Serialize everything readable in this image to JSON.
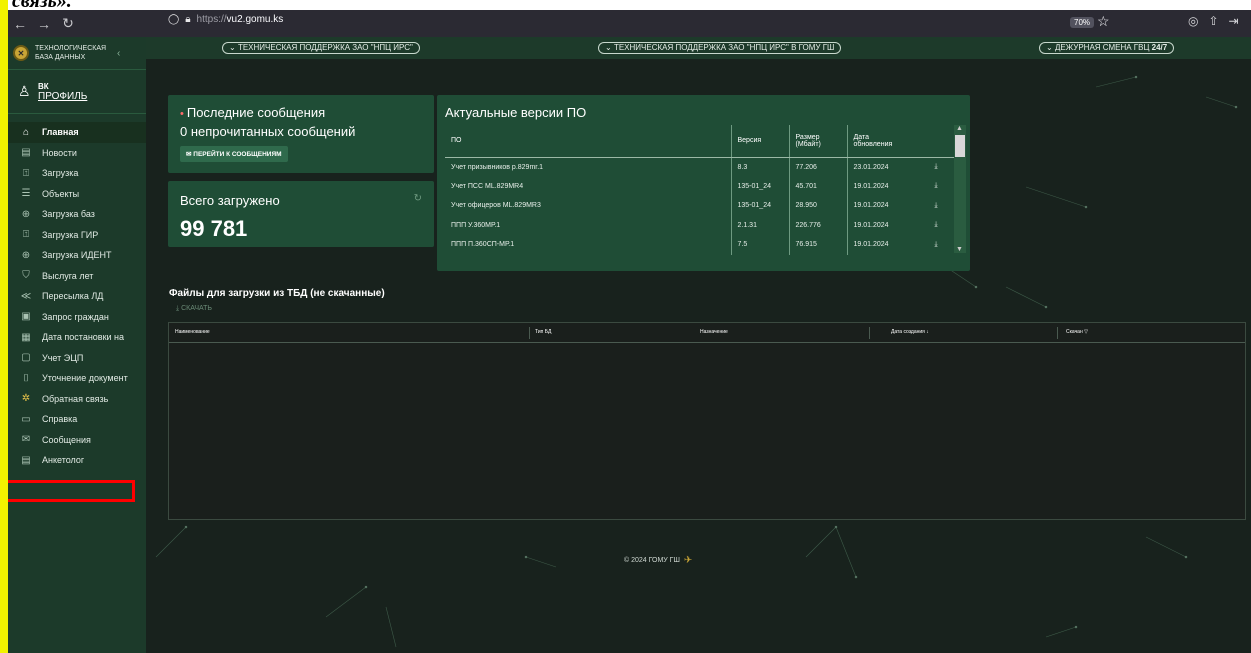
{
  "top_text": "связь».",
  "browser": {
    "url_scheme": "https://",
    "url_host": "vu2.gomu.ks",
    "zoom": "70%"
  },
  "sidebar": {
    "brand": "ТЕХНОЛОГИЧЕСКАЯ БАЗА ДАННЫХ",
    "profile_name": "ВК",
    "profile_link": "ПРОФИЛЬ",
    "items": [
      {
        "label": "Главная",
        "icon": "home-icon"
      },
      {
        "label": "Новости",
        "icon": "news-icon"
      },
      {
        "label": "Загрузка",
        "icon": "upload-icon"
      },
      {
        "label": "Объекты",
        "icon": "list-icon"
      },
      {
        "label": "Загрузка баз",
        "icon": "database-upload-icon"
      },
      {
        "label": "Загрузка ГИР",
        "icon": "upload-icon"
      },
      {
        "label": "Загрузка ИДЕНТ",
        "icon": "database-upload-icon"
      },
      {
        "label": "Выслуга лет",
        "icon": "shield-icon"
      },
      {
        "label": "Пересылка ЛД",
        "icon": "forward-icon"
      },
      {
        "label": "Запрос граждан",
        "icon": "briefcase-icon"
      },
      {
        "label": "Дата постановки на",
        "icon": "calendar-icon"
      },
      {
        "label": "Учет ЭЦП",
        "icon": "signature-icon"
      },
      {
        "label": "Уточнение документ",
        "icon": "document-check-icon"
      },
      {
        "label": "Обратная связь",
        "icon": "feedback-icon"
      },
      {
        "label": "Справка",
        "icon": "folder-icon"
      },
      {
        "label": "Сообщения",
        "icon": "mail-icon"
      },
      {
        "label": "Анкетолог",
        "icon": "form-icon"
      }
    ]
  },
  "topnav": {
    "pill1": "ТЕХНИЧЕСКАЯ ПОДДЕРЖКА ЗАО \"НПЦ ИРС\"",
    "pill2": "ТЕХНИЧЕСКАЯ ПОДДЕРЖКА ЗАО \"НПЦ ИРС\" В ГОМУ ГШ",
    "pill3_prefix": "ДЕЖУРНАЯ СМЕНА ГВЦ ",
    "pill3_bold": "24/7"
  },
  "messages": {
    "title": "Последние сообщения",
    "unread": "0 непрочитанных сообщений",
    "button": "ПЕРЕЙТИ К СООБЩЕНИЯМ"
  },
  "total": {
    "label": "Всего загружено",
    "value": "99 781"
  },
  "versions": {
    "title": "Актуальные версии ПО",
    "headers": [
      "ПО",
      "Версия",
      "Размер (Мбайт)",
      "Дата обновления"
    ],
    "rows": [
      [
        "Учет призывников р.829mr.1",
        "8.3",
        "77.206",
        "23.01.2024"
      ],
      [
        "Учет ПСС ML.829MR4",
        "135-01_24",
        "45.701",
        "19.01.2024"
      ],
      [
        "Учет офицеров ML.829MR3",
        "135-01_24",
        "28.950",
        "19.01.2024"
      ],
      [
        "ППП У.360МР.1",
        "2.1.31",
        "226.776",
        "19.01.2024"
      ],
      [
        "ППП П.360СП-МР.1",
        "7.5",
        "76.915",
        "19.01.2024"
      ]
    ]
  },
  "files": {
    "title": "Файлы для загрузки из ТБД (не скачанные)",
    "download": "СКАЧАТЬ",
    "headers": [
      "Наименование",
      "Тип БД",
      "Назначение",
      "Дата создания",
      "Скачан"
    ]
  },
  "footer": "© 2024 ГОМУ ГШ"
}
